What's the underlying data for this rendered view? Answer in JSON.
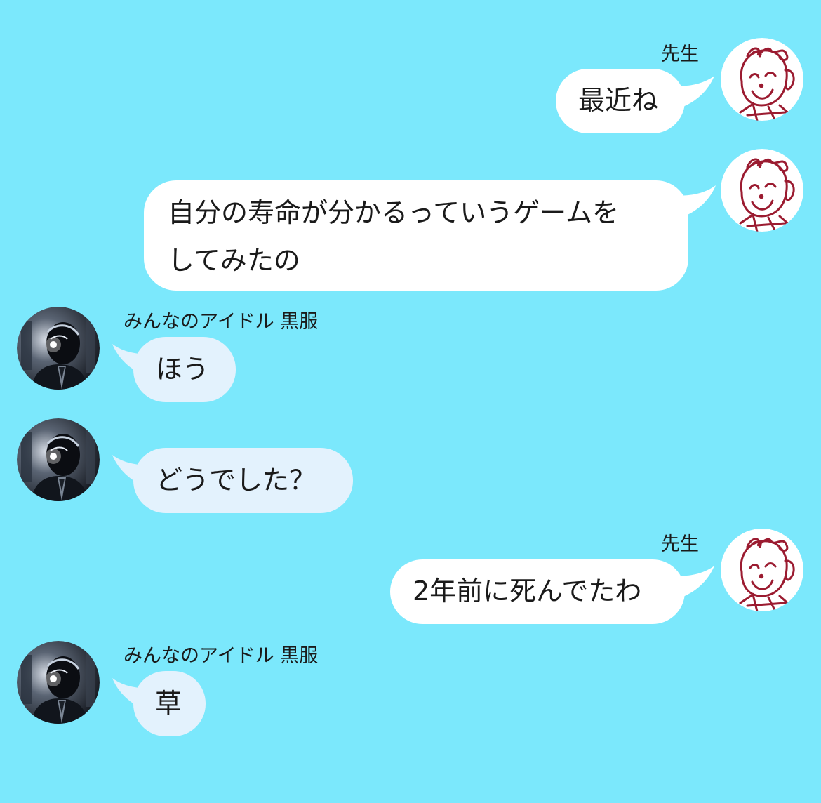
{
  "participants": {
    "self": {
      "name": "先生",
      "avatar_icon": "smiley-doodle-icon"
    },
    "other": {
      "name": "みんなのアイドル 黒服",
      "avatar_icon": "dark-suit-figure-icon"
    }
  },
  "colors": {
    "background": "#7be8fc",
    "self_bubble": "#ffffff",
    "other_bubble": "#e3f2fd",
    "doodle_ink": "#9b1b30"
  },
  "messages": [
    {
      "sender": "先生",
      "side": "right",
      "show_name": true,
      "text": "最近ね"
    },
    {
      "sender": "先生",
      "side": "right",
      "show_name": false,
      "lines": [
        "自分の寿命が分かるっていうゲームを",
        "してみたの"
      ]
    },
    {
      "sender": "みんなのアイドル 黒服",
      "side": "left",
      "show_name": true,
      "text": "ほう"
    },
    {
      "sender": "みんなのアイドル 黒服",
      "side": "left",
      "show_name": false,
      "text": "どうでした？"
    },
    {
      "sender": "先生",
      "side": "right",
      "show_name": true,
      "text": "2年前に死んでたわ"
    },
    {
      "sender": "みんなのアイドル 黒服",
      "side": "left",
      "show_name": true,
      "text": "草"
    }
  ]
}
